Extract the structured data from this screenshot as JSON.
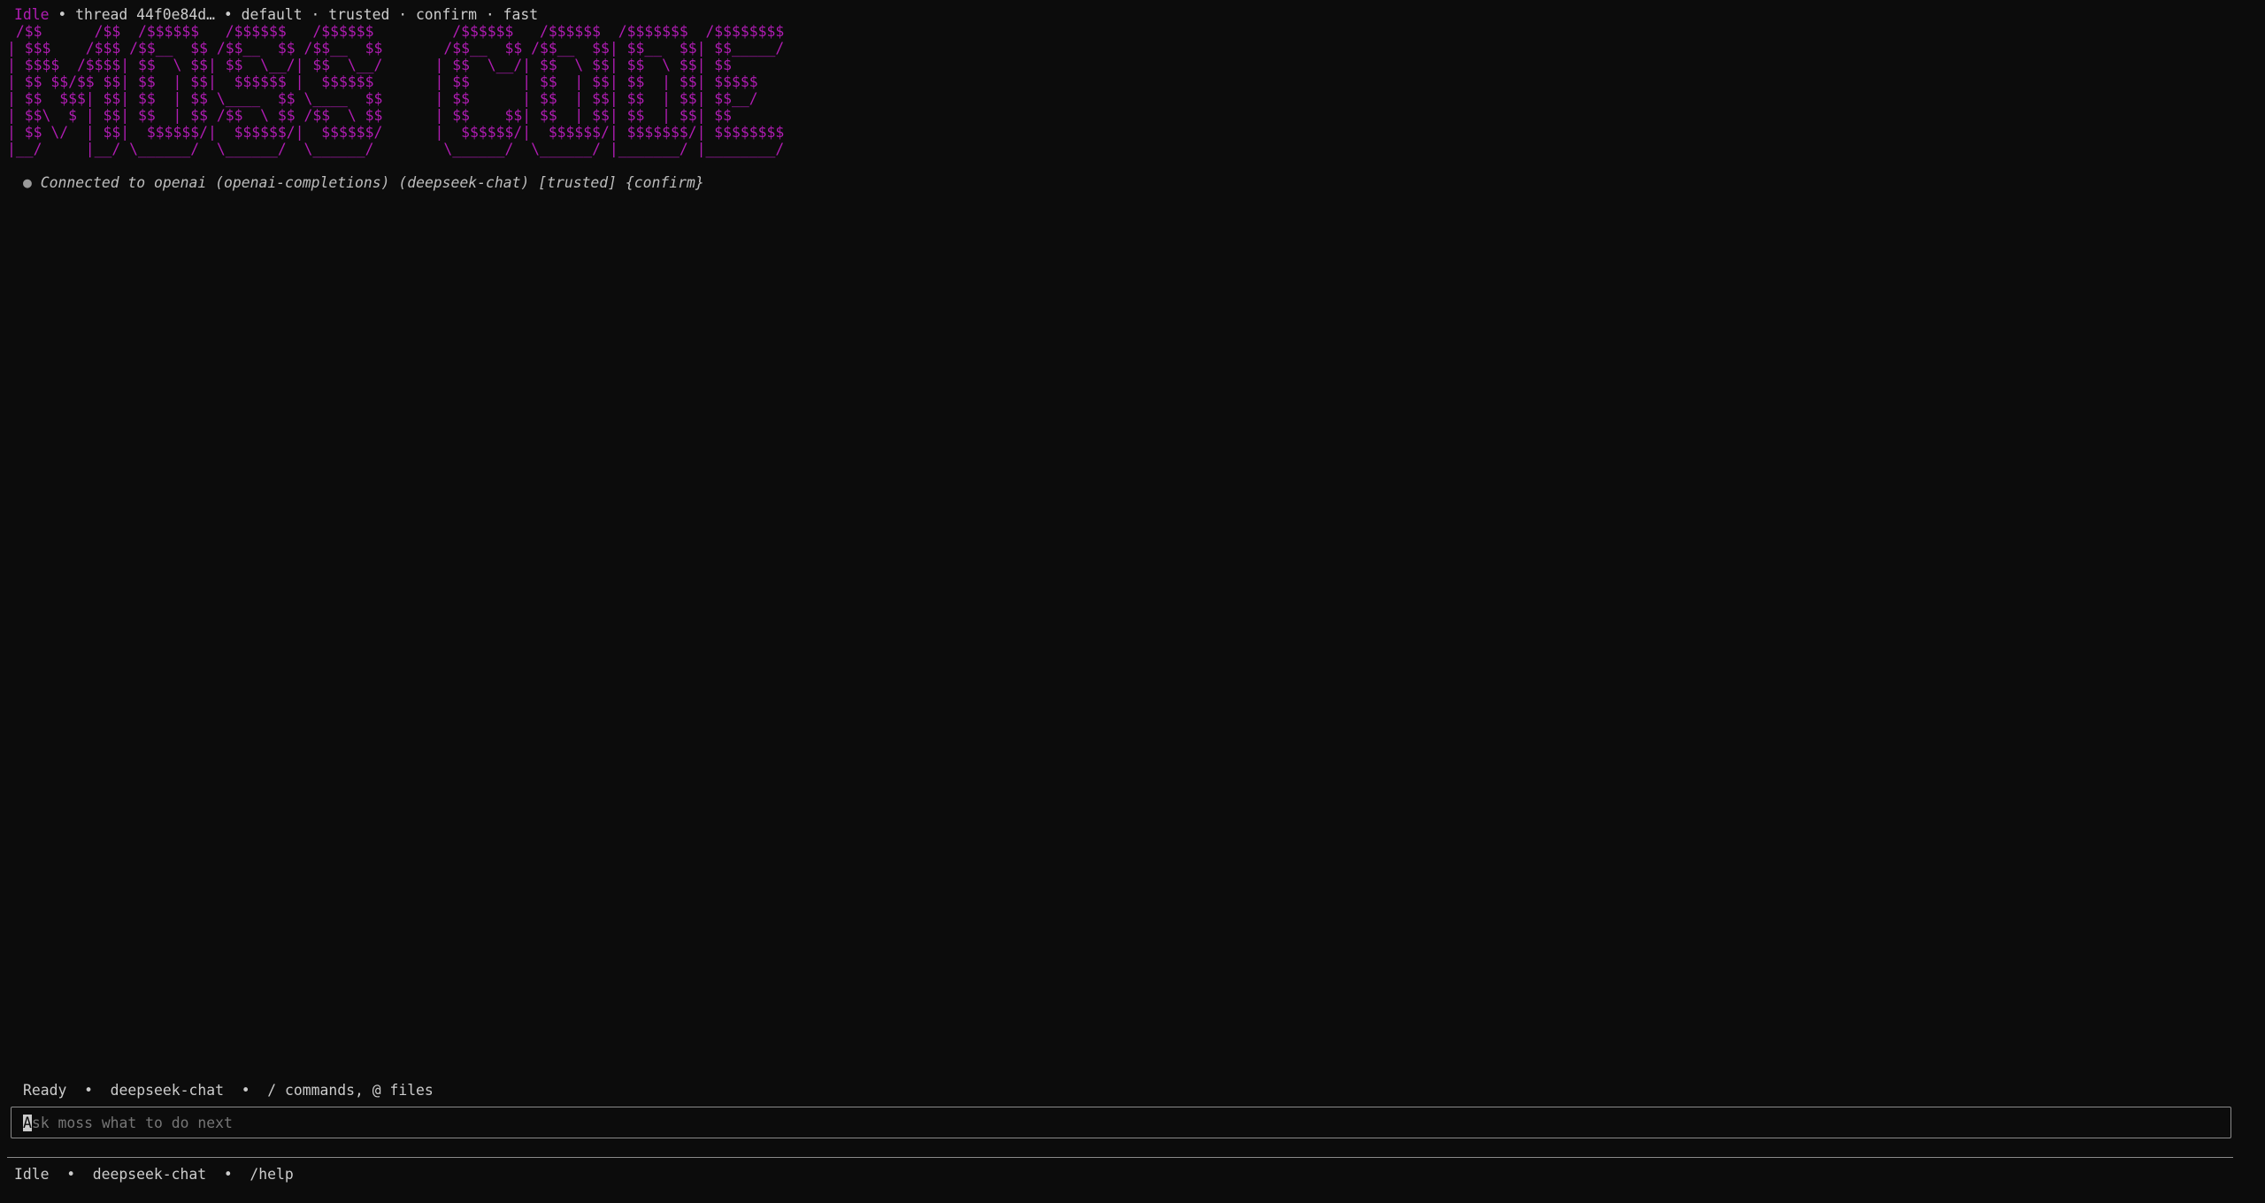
{
  "top_status": {
    "state": "Idle",
    "rest": " • thread 44f0e84d… • default · trusted · confirm · fast"
  },
  "banner_art": " /$$      /$$  /$$$$$$   /$$$$$$   /$$$$$$         /$$$$$$   /$$$$$$  /$$$$$$$  /$$$$$$$$\n| $$$    /$$$ /$$__  $$ /$$__  $$ /$$__  $$       /$$__  $$ /$$__  $$| $$__  $$| $$_____/\n| $$$$  /$$$$| $$  \\ $$| $$  \\__/| $$  \\__/      | $$  \\__/| $$  \\ $$| $$  \\ $$| $$      \n| $$ $$/$$ $$| $$  | $$|  $$$$$$ |  $$$$$$       | $$      | $$  | $$| $$  | $$| $$$$$   \n| $$  $$$| $$| $$  | $$ \\____  $$ \\____  $$      | $$      | $$  | $$| $$  | $$| $$__/   \n| $$\\  $ | $$| $$  | $$ /$$  \\ $$ /$$  \\ $$      | $$    $$| $$  | $$| $$  | $$| $$      \n| $$ \\/  | $$|  $$$$$$/|  $$$$$$/|  $$$$$$/      |  $$$$$$/|  $$$$$$/| $$$$$$$/| $$$$$$$$\n|__/     |__/ \\______/  \\______/  \\______/        \\______/  \\______/ |_______/ |________/",
  "connected": {
    "bullet": "●",
    "text": "Connected to openai (openai-completions) (deepseek-chat) [trusted] {confirm}"
  },
  "ready_line": "Ready  •  deepseek-chat  •  / commands, @ files",
  "input": {
    "cursor_char": "A",
    "placeholder_rest": "sk moss what to do next"
  },
  "bottom_status": "Idle  •  deepseek-chat  •  /help"
}
